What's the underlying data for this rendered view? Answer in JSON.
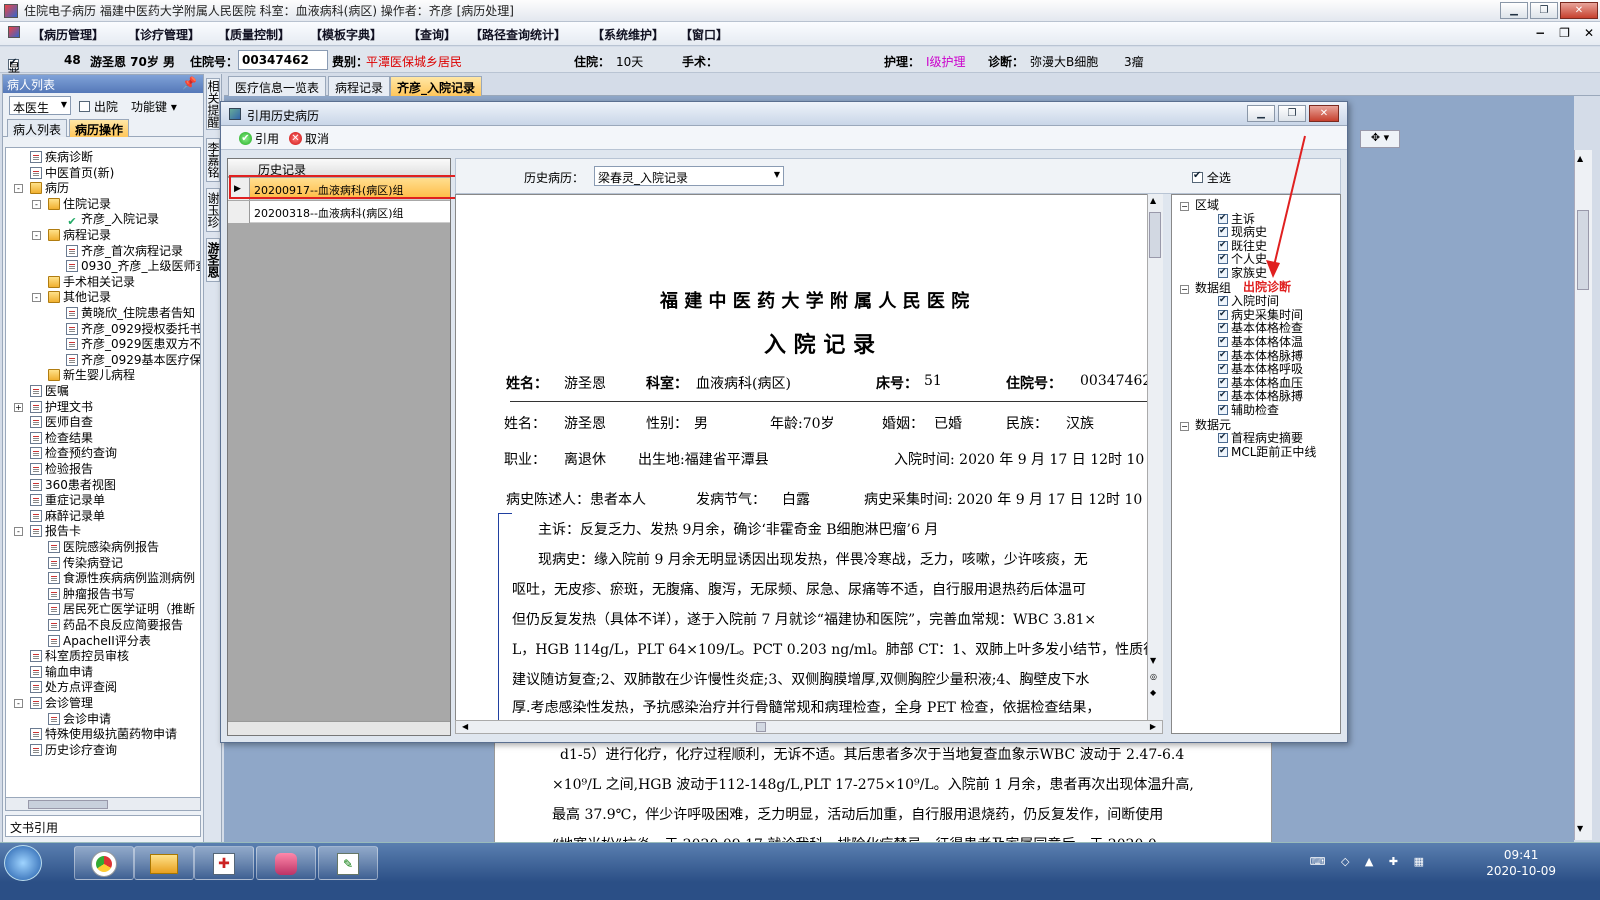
{
  "window": {
    "title": "住院电子病历  福建中医药大学附属人民医院  科室：血液病科(病区) 操作者：齐彦  [病历处理]"
  },
  "menu": [
    "【病历管理】",
    "【诊疗管理】",
    "【质量控制】",
    "【模板字典】",
    "【查询】",
    "【路径查询统计】",
    "【系统维护】",
    "【窗口】"
  ],
  "infobar": {
    "show_label": "显示",
    "bed": "48",
    "patient": "游圣恩  70岁  男",
    "hosp_no_label": "住院号：",
    "hosp_no": "00347462",
    "fee_label": "费别：",
    "fee": "平潭医保城乡居民",
    "stay_label": "住院：",
    "stay": "10天",
    "surgery_label": "手术：",
    "nursing_label": "护理：",
    "nursing": "I级护理",
    "diag_label": "诊断：",
    "diag": "弥漫大B细胞",
    "diag2": "3瘤"
  },
  "left": {
    "header": "病人列表",
    "doctor_combo": "本医生",
    "discharge": "出院",
    "func_key": "功能键",
    "tabs": [
      "病人列表",
      "病历操作"
    ],
    "footer": "文书引用",
    "tree": [
      {
        "label": "疾病诊断",
        "lvl": 1,
        "ic": "doc"
      },
      {
        "label": "中医首页(新)",
        "lvl": 1,
        "ic": "doc"
      },
      {
        "label": "病历",
        "lvl": 1,
        "ic": "fold",
        "exp": "-"
      },
      {
        "label": "住院记录",
        "lvl": 2,
        "ic": "fold",
        "exp": "-"
      },
      {
        "label": "齐彦_入院记录",
        "lvl": 3,
        "ic": "chkd"
      },
      {
        "label": "病程记录",
        "lvl": 2,
        "ic": "fold",
        "exp": "-"
      },
      {
        "label": "齐彦_首次病程记录",
        "lvl": 3,
        "ic": "doc"
      },
      {
        "label": "0930_齐彦_上级医师查",
        "lvl": 3,
        "ic": "doc"
      },
      {
        "label": "手术相关记录",
        "lvl": 2,
        "ic": "fold"
      },
      {
        "label": "其他记录",
        "lvl": 2,
        "ic": "fold",
        "exp": "-"
      },
      {
        "label": "黄晓欣_住院患者告知",
        "lvl": 3,
        "ic": "doc"
      },
      {
        "label": "齐彦_0929授权委托书",
        "lvl": 3,
        "ic": "doc"
      },
      {
        "label": "齐彦_0929医患双方不",
        "lvl": 3,
        "ic": "doc"
      },
      {
        "label": "齐彦_0929基本医疗保",
        "lvl": 3,
        "ic": "doc"
      },
      {
        "label": "新生婴儿病程",
        "lvl": 2,
        "ic": "fold"
      },
      {
        "label": "医嘱",
        "lvl": 1,
        "ic": "doc"
      },
      {
        "label": "护理文书",
        "lvl": 1,
        "ic": "doc",
        "exp": "+"
      },
      {
        "label": "医师自查",
        "lvl": 1,
        "ic": "doc"
      },
      {
        "label": "检查结果",
        "lvl": 1,
        "ic": "doc"
      },
      {
        "label": "检查预约查询",
        "lvl": 1,
        "ic": "doc"
      },
      {
        "label": "检验报告",
        "lvl": 1,
        "ic": "doc"
      },
      {
        "label": "360患者视图",
        "lvl": 1,
        "ic": "doc"
      },
      {
        "label": "重症记录单",
        "lvl": 1,
        "ic": "doc"
      },
      {
        "label": "麻醉记录单",
        "lvl": 1,
        "ic": "doc"
      },
      {
        "label": "报告卡",
        "lvl": 1,
        "ic": "doc",
        "exp": "-"
      },
      {
        "label": "医院感染病例报告",
        "lvl": 2,
        "ic": "doc"
      },
      {
        "label": "传染病登记",
        "lvl": 2,
        "ic": "doc"
      },
      {
        "label": "食源性疾病病例监测病例",
        "lvl": 2,
        "ic": "doc"
      },
      {
        "label": "肿瘤报告书写",
        "lvl": 2,
        "ic": "doc"
      },
      {
        "label": "居民死亡医学证明（推断",
        "lvl": 2,
        "ic": "doc"
      },
      {
        "label": "药品不良反应简要报告",
        "lvl": 2,
        "ic": "doc"
      },
      {
        "label": "ApacheII评分表",
        "lvl": 2,
        "ic": "doc"
      },
      {
        "label": "科室质控员审核",
        "lvl": 1,
        "ic": "doc"
      },
      {
        "label": "输血申请",
        "lvl": 1,
        "ic": "doc"
      },
      {
        "label": "处方点评查阅",
        "lvl": 1,
        "ic": "doc"
      },
      {
        "label": "会诊管理",
        "lvl": 1,
        "ic": "doc",
        "exp": "-"
      },
      {
        "label": "会诊申请",
        "lvl": 2,
        "ic": "doc"
      },
      {
        "label": "特殊使用级抗菌药物申请",
        "lvl": 1,
        "ic": "doc"
      },
      {
        "label": "历史诊疗查询",
        "lvl": 1,
        "ic": "doc"
      }
    ]
  },
  "vtabs": [
    "相关提醒",
    "李嘉铭",
    "谢玉珍",
    "游圣恩"
  ],
  "doctabs": [
    "医疗信息一览表",
    "病程记录",
    "齐彦_入院记录"
  ],
  "dialog": {
    "title": "引用历史病历",
    "btn_ref": "引用",
    "btn_cancel": "取消",
    "hist_header": "历史记录",
    "hist_rows": [
      "20200917--血液病科(病区)组",
      "20200318--血液病科(病区)组"
    ],
    "hist_combo_label": "历史病历：",
    "hist_combo": "梁春灵_入院记录",
    "select_all": "全选",
    "annotation": "出院诊断",
    "preview": {
      "hospital": "福 建 中 医 药 大 学 附 属 人 民 医 院",
      "doc_title": "入  院  记  录",
      "h_name_l": "姓名：",
      "h_name": "游圣恩",
      "h_dept_l": "科室：",
      "h_dept": "血液病科(病区)",
      "h_bed_l": "床号：",
      "h_bed": "51",
      "h_no_l": "住院号：",
      "h_no": "00347462_",
      "r1": [
        "姓名：",
        "游圣恩",
        "性别：",
        "男",
        "年龄:70岁",
        "婚姻：",
        "已婚",
        "民族：",
        "汉族"
      ],
      "r2": [
        "职业：",
        "离退休",
        "出生地:福建省平潭县",
        "入院时间: 2020 年 9 月 17 日 12时 10"
      ],
      "r3": [
        "病史陈述人：患者本人",
        "发病节气：",
        "白露",
        "病史采集时间: 2020 年 9 月 17 日 12时 10"
      ],
      "lines": [
        "主诉：反复乏力、发热 9月余，确诊‘非霍奇金 B细胞淋巴瘤’6 月",
        "现病史：缘入院前 9 月余无明显诱因出现发热，伴畏冷寒战，乏力，咳嗽，少许咳痰，无",
        "呕吐，无皮疹、瘀斑，无腹痛、腹泻，无尿频、尿急、尿痛等不适，自行服用退热药后体温可",
        "但仍反复发热（具体不详），遂于入院前 7 月就诊“福建协和医院”，完善血常规：WBC 3.81×",
        "L，HGB 114g/L，PLT 64×109/L。PCT 0.203 ng/ml。肺部 CT：1、双肺上叶多发小结节，性质待",
        "建议随访复查;2、双肺散在少许慢性炎症;3、双侧胸膜增厚,双侧胸腔少量积液;4、胸壁皮下水",
        "厚.考虑感染性发热，予抗感染治疗并行骨髓常规和病理检查，全身 PET 检查，依据检查结果，"
      ]
    },
    "tree": [
      {
        "label": "区域",
        "t": "grp"
      },
      {
        "label": "主诉",
        "t": "c"
      },
      {
        "label": "现病史",
        "t": "c"
      },
      {
        "label": "既往史",
        "t": "c"
      },
      {
        "label": "个人史",
        "t": "c"
      },
      {
        "label": "家族史",
        "t": "c"
      },
      {
        "label": "数据组",
        "t": "grp"
      },
      {
        "label": "入院时间",
        "t": "c"
      },
      {
        "label": "病史采集时间",
        "t": "c"
      },
      {
        "label": "基本体格检查",
        "t": "c"
      },
      {
        "label": "基本体格体温",
        "t": "c"
      },
      {
        "label": "基本体格脉搏",
        "t": "c"
      },
      {
        "label": "基本体格呼吸",
        "t": "c"
      },
      {
        "label": "基本体格血压",
        "t": "c"
      },
      {
        "label": "基本体格脉搏",
        "t": "c"
      },
      {
        "label": "辅助检查",
        "t": "c"
      },
      {
        "label": "数据元",
        "t": "grp"
      },
      {
        "label": "首程病史摘要",
        "t": "c"
      },
      {
        "label": "MCL距前正中线",
        "t": "c"
      }
    ]
  },
  "background_text": [
    "d1-5）进行化疗，化疗过程顺利，无诉不适。其后患者多次于当地复查血象示WBC 波动于 2.47-6.4",
    "×10⁹/L 之间,HGB 波动于112-148g/L,PLT 17-275×10⁹/L。入院前 1 月余，患者再次出现体温升高,",
    "最高 37.9℃，伴少许呼吸困难，乏力明显，活动后加重，自行服用退烧药，仍反复发作，间断使用",
    "“地塞米松”抗炎，于 2020.09.17 就诊我科，排除化疗禁忌，征得患者及家属同意后，于 2020.0"
  ],
  "taskbar": {
    "time": "09:41",
    "date": "2020-10-09"
  }
}
